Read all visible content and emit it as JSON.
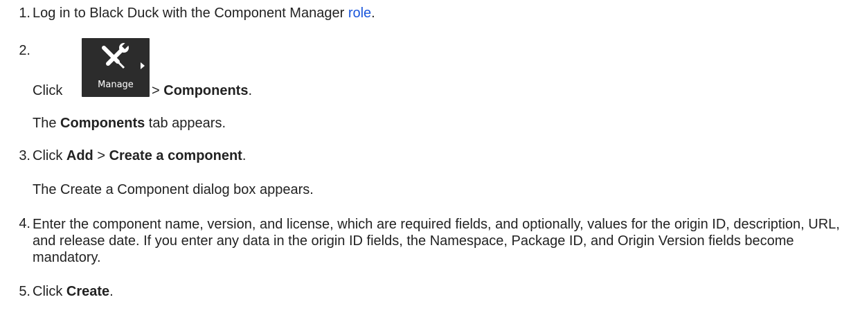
{
  "steps": [
    {
      "number": "1.",
      "text_before": "Log in to Black Duck with the Component Manager ",
      "link_text": "role",
      "text_after": "."
    },
    {
      "number": "2.",
      "click_prefix": "Click ",
      "button_label": "Manage",
      "button_icon": "wrench-screwdriver-icon",
      "separator": " > ",
      "target": "Components",
      "end": ".",
      "result_bold": "Components",
      "result_rest": " tab appears.",
      "result_prefix": "The "
    },
    {
      "number": "3.",
      "click_prefix": "Click ",
      "first": "Add",
      "separator": " > ",
      "second": "Create a component",
      "end": ".",
      "result": "The Create a Component dialog box appears."
    },
    {
      "number": "4.",
      "text": "Enter the component name, version, and license, which are required fields, and optionally, values for the origin ID, description, URL, and release date. If you enter any data in the origin ID fields, the Namespace, Package ID, and Origin Version fields become mandatory."
    },
    {
      "number": "5.",
      "click_prefix": "Click ",
      "target": "Create",
      "end": "."
    }
  ],
  "colors": {
    "text": "#222222",
    "link": "#1a56db",
    "button_bg": "#2c2c2c",
    "button_text": "#ffffff"
  }
}
